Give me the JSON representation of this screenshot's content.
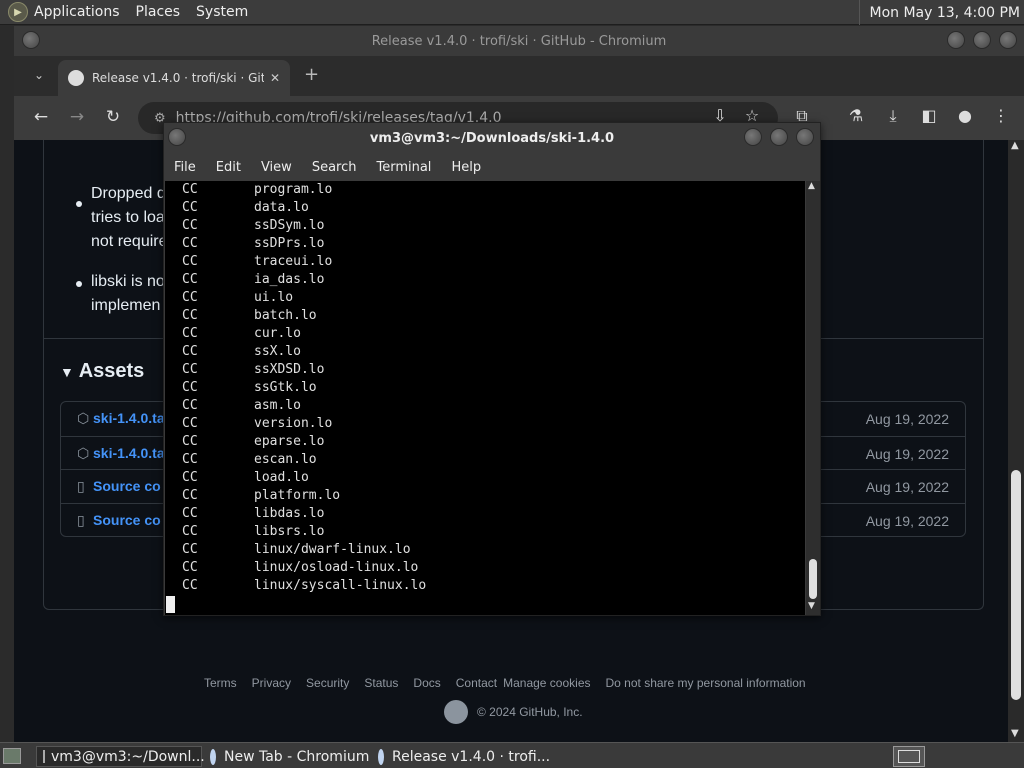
{
  "top_panel": {
    "menus": [
      "Applications",
      "Places",
      "System"
    ],
    "clock": "Mon May 13,  4:00 PM"
  },
  "chromium": {
    "window_title": "Release v1.4.0 · trofi/ski · GitHub - Chromium",
    "tab_title": "Release v1.4.0 · trofi/ski · GitHub",
    "url": "https://github.com/trofi/ski/releases/tag/v1.4.0"
  },
  "release": {
    "notes": [
      "Dropped d",
      "tries to loa",
      "not require",
      "libski is no",
      "implemen"
    ],
    "assets_heading": "Assets",
    "assets": [
      {
        "name": "ski-1.4.0.ta",
        "date": "Aug 19, 2022",
        "icon": "package-icon"
      },
      {
        "name": "ski-1.4.0.ta",
        "date": "Aug 19, 2022",
        "icon": "package-icon"
      },
      {
        "name": "Source co",
        "date": "Aug 19, 2022",
        "icon": "zip-icon"
      },
      {
        "name": "Source co",
        "date": "Aug 19, 2022",
        "icon": "zip-icon"
      }
    ]
  },
  "footer": {
    "links": [
      "Terms",
      "Privacy",
      "Security",
      "Status",
      "Docs",
      "Contact",
      "Manage cookies",
      "Do not share my personal information"
    ],
    "copyright": "© 2024 GitHub, Inc."
  },
  "terminal": {
    "title": "vm3@vm3:~/Downloads/ski-1.4.0",
    "menus": [
      "File",
      "Edit",
      "View",
      "Search",
      "Terminal",
      "Help"
    ],
    "lines": [
      {
        "cmd": "CC",
        "file": "program.lo"
      },
      {
        "cmd": "CC",
        "file": "data.lo"
      },
      {
        "cmd": "CC",
        "file": "ssDSym.lo"
      },
      {
        "cmd": "CC",
        "file": "ssDPrs.lo"
      },
      {
        "cmd": "CC",
        "file": "traceui.lo"
      },
      {
        "cmd": "CC",
        "file": "ia_das.lo"
      },
      {
        "cmd": "CC",
        "file": "ui.lo"
      },
      {
        "cmd": "CC",
        "file": "batch.lo"
      },
      {
        "cmd": "CC",
        "file": "cur.lo"
      },
      {
        "cmd": "CC",
        "file": "ssX.lo"
      },
      {
        "cmd": "CC",
        "file": "ssXDSD.lo"
      },
      {
        "cmd": "CC",
        "file": "ssGtk.lo"
      },
      {
        "cmd": "CC",
        "file": "asm.lo"
      },
      {
        "cmd": "CC",
        "file": "version.lo"
      },
      {
        "cmd": "CC",
        "file": "eparse.lo"
      },
      {
        "cmd": "CC",
        "file": "escan.lo"
      },
      {
        "cmd": "CC",
        "file": "load.lo"
      },
      {
        "cmd": "CC",
        "file": "platform.lo"
      },
      {
        "cmd": "CC",
        "file": "libdas.lo"
      },
      {
        "cmd": "CC",
        "file": "libsrs.lo"
      },
      {
        "cmd": "CC",
        "file": "linux/dwarf-linux.lo"
      },
      {
        "cmd": "CC",
        "file": "linux/osload-linux.lo"
      },
      {
        "cmd": "CC",
        "file": "linux/syscall-linux.lo"
      }
    ]
  },
  "taskbar": {
    "tasks": [
      "vm3@vm3:~/Downl...",
      "New Tab - Chromium",
      "Release v1.4.0 · trofi..."
    ]
  }
}
